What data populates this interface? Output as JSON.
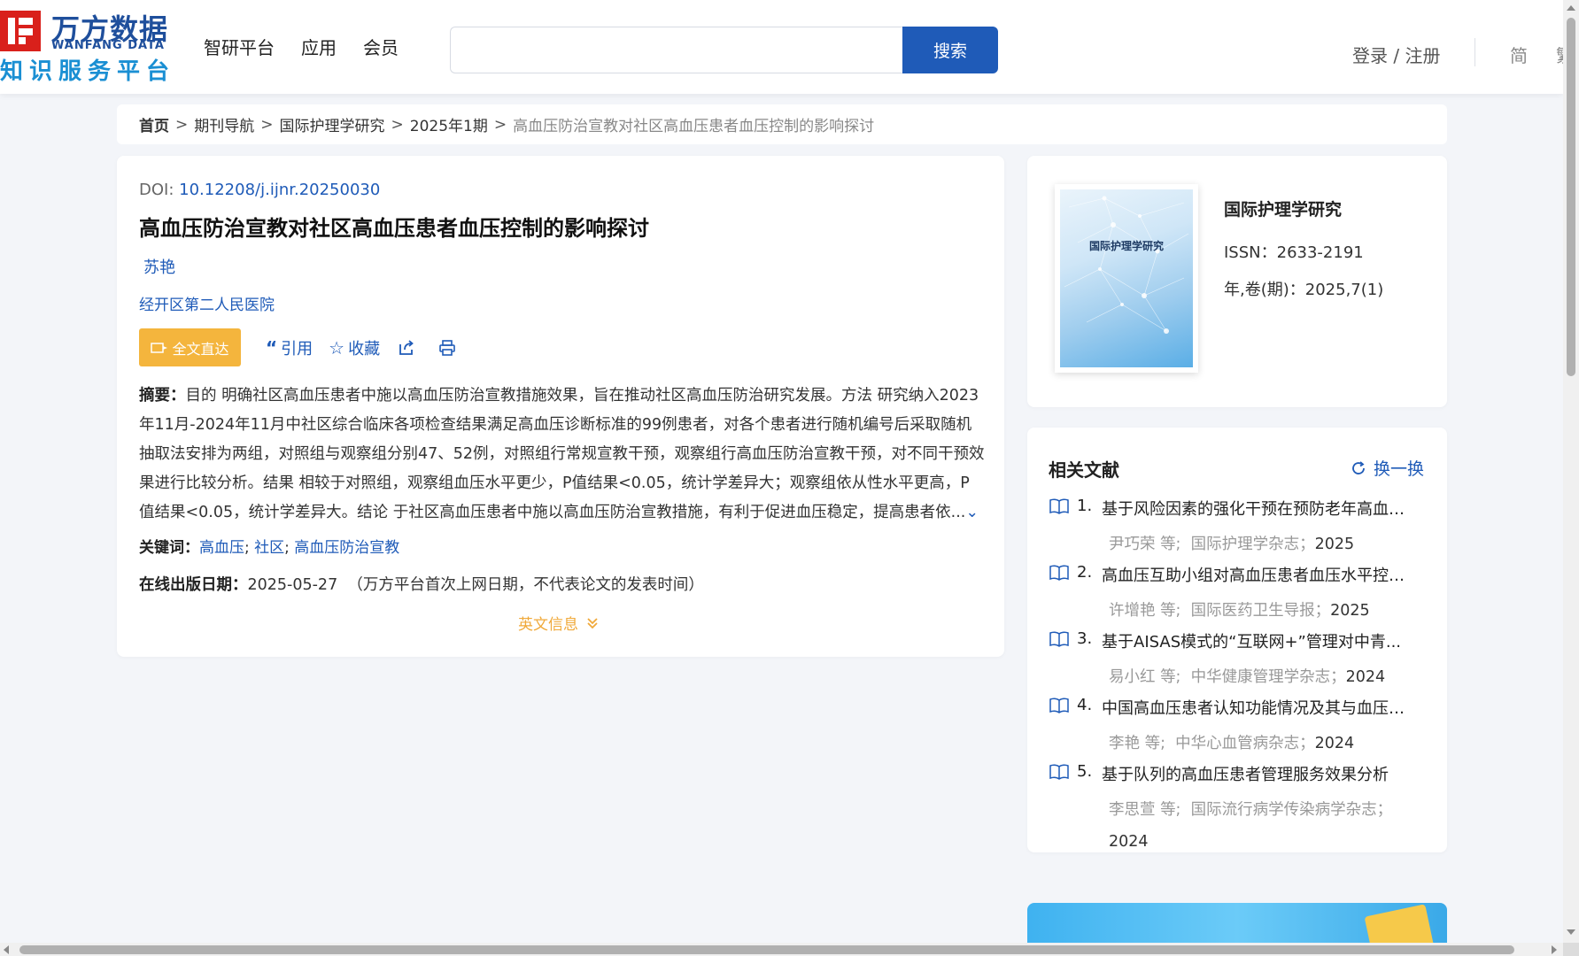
{
  "header": {
    "logo_cn": "万方数据",
    "logo_en": "WANFANG DATA",
    "logo_sub": "知识服务平台",
    "nav": [
      "智研平台",
      "应用",
      "会员"
    ],
    "search_placeholder": "",
    "search_button": "搜索",
    "login": "登录 / 注册",
    "lang_simplified": "简",
    "lang_traditional": "繁"
  },
  "breadcrumb": {
    "home": "首页",
    "items": [
      "期刊导航",
      "国际护理学研究",
      "2025年1期"
    ],
    "current": "高血压防治宣教对社区高血压患者血压控制的影响探讨",
    "separator": ">"
  },
  "article": {
    "doi_label": "DOI:",
    "doi": "10.12208/j.ijnr.20250030",
    "title": "高血压防治宣教对社区高血压患者血压控制的影响探讨",
    "author": "苏艳",
    "organization": "经开区第二人民医院",
    "actions": {
      "fulltext": "全文直达",
      "cite": "引用",
      "favorite": "收藏"
    },
    "abstract_label": "摘要：",
    "abstract": "目的 明确社区高血压患者中施以高血压防治宣教措施效果，旨在推动社区高血压防治研究发展。方法 研究纳入2023年11月-2024年11月中社区综合临床各项检查结果满足高血压诊断标准的99例患者，对各个患者进行随机编号后采取随机抽取法安排为两组，对照组与观察组分别47、52例，对照组行常规宣教干预，观察组行高血压防治宣教干预，对不同干预效果进行比较分析。结果 相较于对照组，观察组血压水平更少，P值结果<0.05，统计学差异大；观察组依从性水平更高，P值结果<0.05，统计学差异大。结论 于社区高血压患者中施以高血压防治宣教措施，有利于促进血压稳定，提高患者依...",
    "keywords_label": "关键词：",
    "keywords": [
      "高血压",
      "社区",
      "高血压防治宣教"
    ],
    "pubdate_label": "在线出版日期：",
    "pubdate": "2025-05-27",
    "pubdate_note": "（万方平台首次上网日期，不代表论文的发表时间）",
    "english_info": "英文信息"
  },
  "journal": {
    "cover_title": "国际护理学研究",
    "name": "国际护理学研究",
    "issn_label": "ISSN：",
    "issn": "2633-2191",
    "volume_label": "年,卷(期)：",
    "volume": "2025,7(1)"
  },
  "related": {
    "title": "相关文献",
    "refresh": "换一换",
    "items": [
      {
        "num": "1.",
        "title": "基于风险因素的强化干预在预防老年高血压...",
        "authors": "尹巧荣 等;",
        "source": "国际护理学杂志；",
        "year": "2025"
      },
      {
        "num": "2.",
        "title": "高血压互助小组对高血压患者血压水平控制...",
        "authors": "许增艳 等;",
        "source": "国际医药卫生导报；",
        "year": "2025"
      },
      {
        "num": "3.",
        "title": "基于AISAS模式的“互联网+”管理对中青...",
        "authors": "易小红 等;",
        "source": "中华健康管理学杂志；",
        "year": "2024"
      },
      {
        "num": "4.",
        "title": "中国高血压患者认知功能情况及其与血压控...",
        "authors": "李艳 等;",
        "source": "中华心血管病杂志；",
        "year": "2024"
      },
      {
        "num": "5.",
        "title": "基于队列的高血压患者管理服务效果分析",
        "authors": "李思萱 等;",
        "source": "国际流行病学传染病学杂志；",
        "year": "2024"
      }
    ]
  },
  "colors": {
    "accent": "#1f5bb8",
    "brand_red": "#d9201b",
    "fulltext_button": "#f4b53d",
    "english_info": "#f0a93a"
  }
}
